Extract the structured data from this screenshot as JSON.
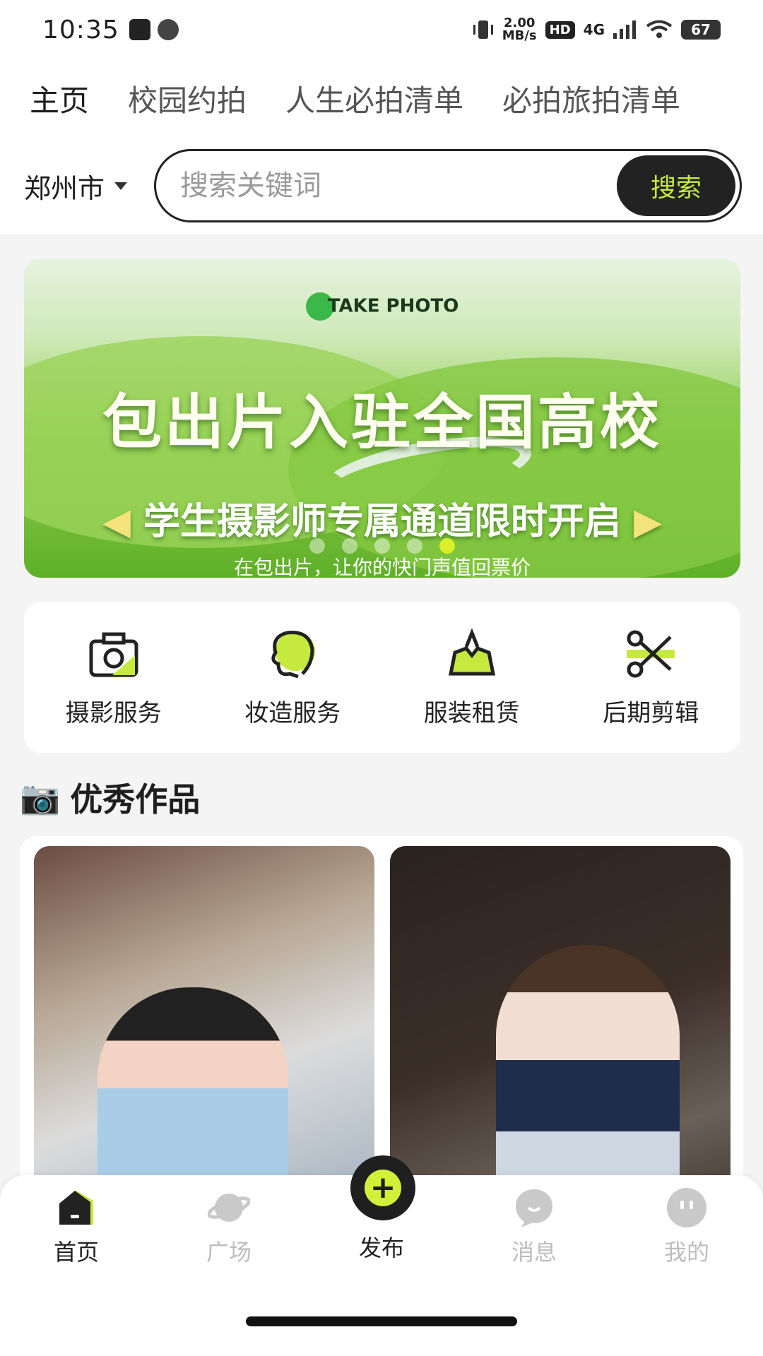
{
  "status": {
    "time": "10:35",
    "netspeed_value": "2.00",
    "netspeed_unit": "MB/s",
    "hd": "HD",
    "network": "4G",
    "battery": "67"
  },
  "tabs": [
    {
      "label": "主页",
      "active": true
    },
    {
      "label": "校园约拍",
      "active": false
    },
    {
      "label": "人生必拍清单",
      "active": false
    },
    {
      "label": "必拍旅拍清单",
      "active": false
    }
  ],
  "search": {
    "city": "郑州市",
    "placeholder": "搜索关键词",
    "button": "搜索"
  },
  "banner": {
    "brand": "TAKE PHOTO",
    "title": "包出片入驻全国高校",
    "subtitle": "学生摄影师专属通道限时开启",
    "small": "在包出片，让你的快门声值回票价",
    "arrow_left": "◀",
    "arrow_right": "▶",
    "active_dot": 5
  },
  "services": [
    {
      "label": "摄影服务",
      "icon": "camera-icon"
    },
    {
      "label": "妆造服务",
      "icon": "makeup-icon"
    },
    {
      "label": "服装租赁",
      "icon": "clothing-icon"
    },
    {
      "label": "后期剪辑",
      "icon": "scissors-icon"
    }
  ],
  "section": {
    "emoji": "📷",
    "title": "优秀作品"
  },
  "nav": [
    {
      "label": "首页",
      "icon": "home-icon",
      "active": true
    },
    {
      "label": "广场",
      "icon": "planet-icon",
      "active": false
    },
    {
      "label": "发布",
      "icon": "plus-icon",
      "active": false
    },
    {
      "label": "消息",
      "icon": "message-icon",
      "active": false
    },
    {
      "label": "我的",
      "icon": "profile-icon",
      "active": false
    }
  ],
  "colors": {
    "accent": "#c6e940",
    "dark": "#1f1f1f"
  }
}
